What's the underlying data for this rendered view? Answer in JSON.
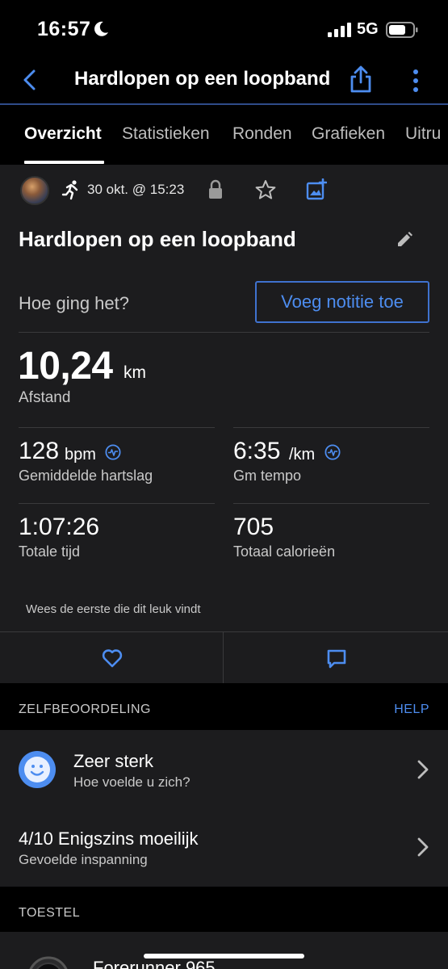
{
  "status": {
    "time": "16:57",
    "network": "5G"
  },
  "header": {
    "title": "Hardlopen op een loopband"
  },
  "tabs": [
    {
      "label": "Overzicht"
    },
    {
      "label": "Statistieken"
    },
    {
      "label": "Ronden"
    },
    {
      "label": "Grafieken"
    },
    {
      "label": "Uitru"
    }
  ],
  "activity": {
    "date": "30 okt. @ 15:23",
    "title": "Hardlopen op een loopband",
    "feel_prompt": "Hoe ging het?",
    "note_button": "Voeg notitie toe",
    "distance_value": "10,24",
    "distance_unit": "km",
    "distance_label": "Afstand",
    "stats": [
      {
        "value": "128",
        "unit": "bpm",
        "label": "Gemiddelde hartslag"
      },
      {
        "value": "6:35",
        "unit": "/km",
        "label": "Gm tempo"
      },
      {
        "value": "1:07:26",
        "unit": "",
        "label": "Totale tijd"
      },
      {
        "value": "705",
        "unit": "",
        "label": "Totaal calorieën"
      }
    ],
    "likes_text": "Wees de eerste die dit leuk vindt"
  },
  "self_eval": {
    "section_title": "ZELFBEOORDELING",
    "help_label": "HELP",
    "feeling_title": "Zeer sterk",
    "feeling_sub": "Hoe voelde u zich?",
    "effort_title": "4/10 Enigszins moeilijk",
    "effort_sub": "Gevoelde inspanning"
  },
  "device": {
    "section_title": "TOESTEL",
    "name": "Forerunner 965"
  },
  "colors": {
    "accent": "#4d8df0",
    "card": "#1c1c1e",
    "background": "#000000"
  }
}
